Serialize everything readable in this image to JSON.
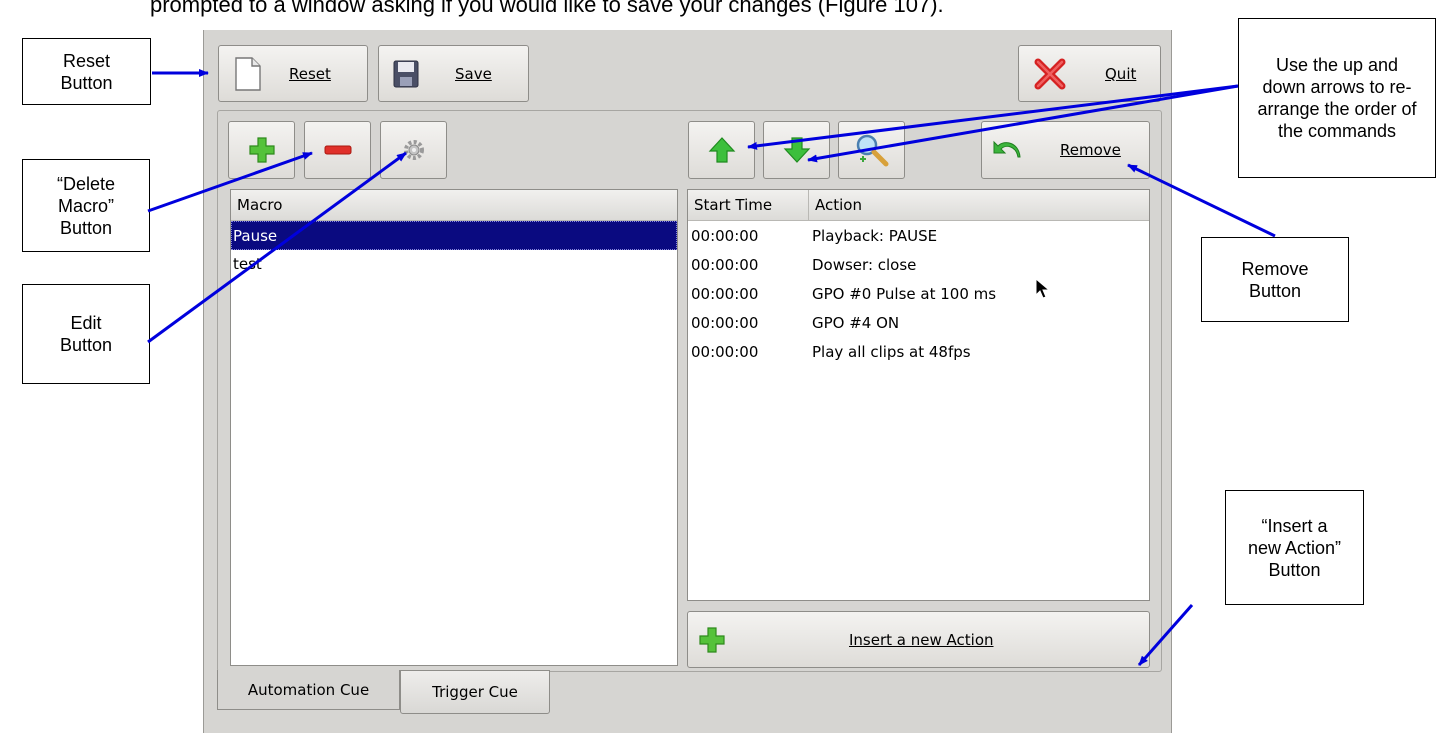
{
  "intro_text": "prompted to a window asking if you would like to save your changes (Figure 107).",
  "toolbar": {
    "reset_label": "Reset",
    "save_label": "Save",
    "quit_label": "Quit"
  },
  "macro_list": {
    "header": "Macro",
    "items": [
      "Pause",
      "test"
    ],
    "selected": "Pause"
  },
  "actions": {
    "headers": [
      "Start Time",
      "Action"
    ],
    "rows": [
      [
        "00:00:00",
        "Playback: PAUSE"
      ],
      [
        "00:00:00",
        "Dowser: close"
      ],
      [
        "00:00:00",
        "GPO #0 Pulse at 100 ms"
      ],
      [
        "00:00:00",
        "GPO #4 ON"
      ],
      [
        "00:00:00",
        "Play all clips at 48fps"
      ]
    ],
    "remove_label": "Remove",
    "insert_label": "Insert a new Action"
  },
  "tabs": [
    "Automation Cue",
    "Trigger Cue"
  ],
  "active_tab": "Automation Cue",
  "callouts": {
    "reset": "Reset Button",
    "delete_macro": "“Delete Macro” Button",
    "edit": "Edit Button",
    "arrows": "Use the up and down arrows to re-arrange the order of the commands",
    "remove": "Remove Button",
    "insert": "“Insert a new Action” Button"
  },
  "colors": {
    "arrow": "#0000dd",
    "selection": "#0a0a80",
    "window_bg": "#d6d5d2"
  }
}
